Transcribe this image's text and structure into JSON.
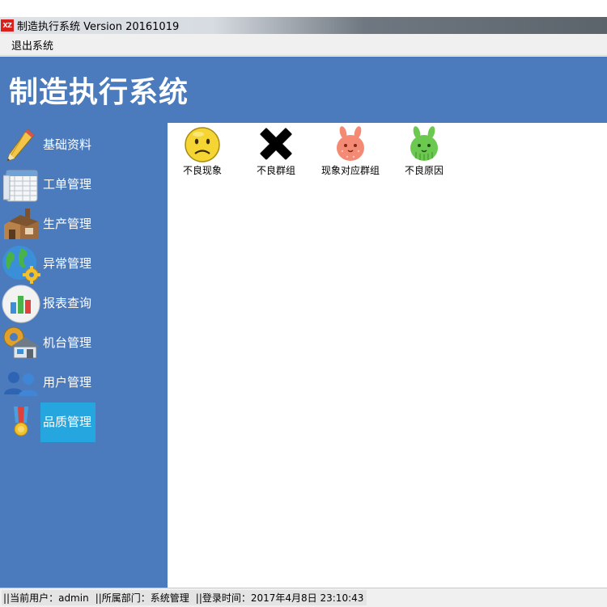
{
  "window": {
    "app_icon_text": "XZ",
    "title": "制造执行系统 Version 20161019"
  },
  "menu": {
    "items": [
      {
        "label": "退出系统"
      }
    ]
  },
  "header": {
    "title": "制造执行系统"
  },
  "sidebar": {
    "items": [
      {
        "label": "基础资料",
        "icon": "pencil-icon"
      },
      {
        "label": "工单管理",
        "icon": "spreadsheet-icon"
      },
      {
        "label": "生产管理",
        "icon": "factory-icon"
      },
      {
        "label": "异常管理",
        "icon": "globe-gear-icon"
      },
      {
        "label": "报表查询",
        "icon": "bar-chart-icon"
      },
      {
        "label": "机台管理",
        "icon": "machine-house-icon"
      },
      {
        "label": "用户管理",
        "icon": "users-icon"
      },
      {
        "label": "品质管理",
        "icon": "medal-icon",
        "active": true
      }
    ],
    "active_color": "#26a6df",
    "background_color": "#4b7bbd"
  },
  "content": {
    "tiles": [
      {
        "label": "不良现象",
        "icon": "sad-face-icon"
      },
      {
        "label": "不良群组",
        "icon": "black-x-icon"
      },
      {
        "label": "现象对应群组",
        "icon": "pink-bunny-icon"
      },
      {
        "label": "不良原因",
        "icon": "green-bunny-icon"
      }
    ]
  },
  "status": {
    "user": "||当前用户：admin",
    "dept": "||所属部门：系统管理",
    "login_time": "||登录时间：2017年4月8日 23:10:43"
  }
}
